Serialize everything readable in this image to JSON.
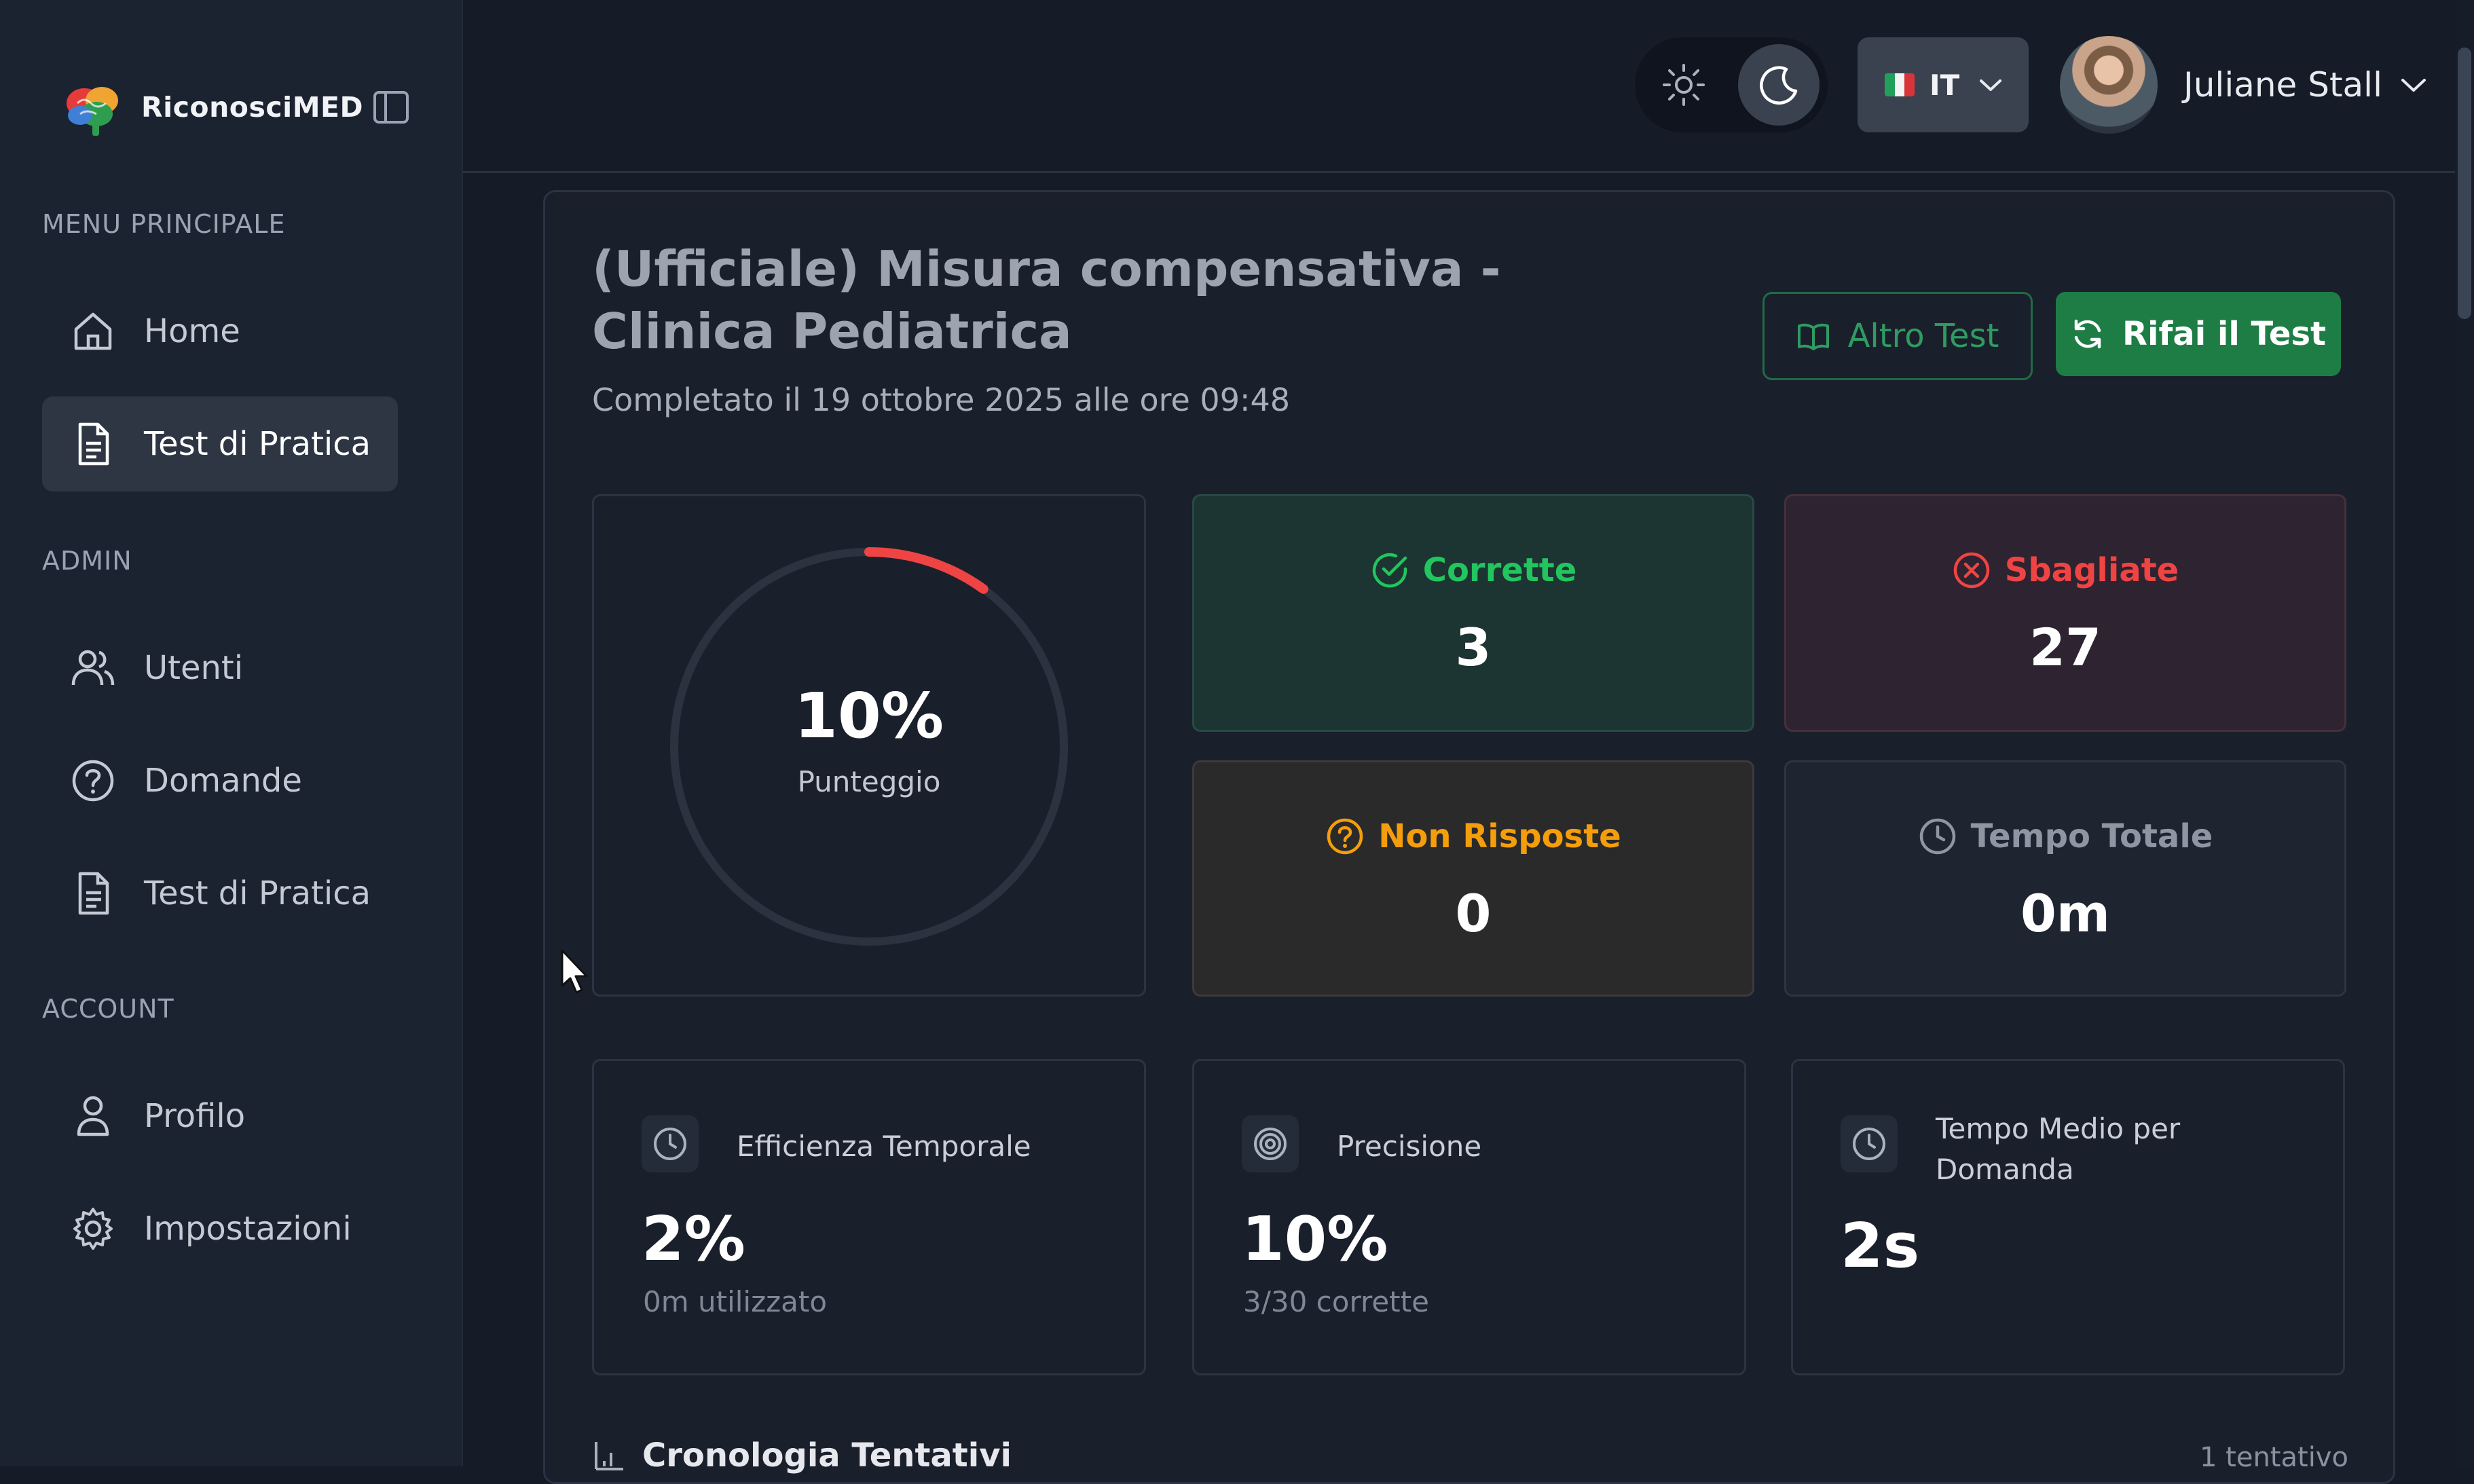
{
  "app": {
    "name": "RiconosciMED"
  },
  "sidebar": {
    "sections": [
      {
        "title": "MENU PRINCIPALE",
        "items": [
          {
            "label": "Home",
            "icon": "home-icon"
          },
          {
            "label": "Test di Pratica",
            "icon": "document-icon",
            "active": true
          }
        ]
      },
      {
        "title": "ADMIN",
        "items": [
          {
            "label": "Utenti",
            "icon": "users-icon"
          },
          {
            "label": "Domande",
            "icon": "question-circle-icon"
          },
          {
            "label": "Test di Pratica",
            "icon": "document-icon"
          }
        ]
      },
      {
        "title": "ACCOUNT",
        "items": [
          {
            "label": "Profilo",
            "icon": "user-icon"
          },
          {
            "label": "Impostazioni",
            "icon": "gear-icon"
          }
        ]
      }
    ]
  },
  "header": {
    "language": "IT",
    "user_name": "Juliane Stall",
    "theme": "dark"
  },
  "result": {
    "title": "(Ufficiale) Misura compensativa - Clinica Pediatrica",
    "completed": "Completato il 19 ottobre 2025 alle ore 09:48",
    "buttons": {
      "other": "Altro Test",
      "retake": "Rifai il Test"
    },
    "score": {
      "value": "10%",
      "fraction": 0.1,
      "label": "Punteggio"
    },
    "stats": {
      "correct": {
        "label": "Corrette",
        "value": "3"
      },
      "wrong": {
        "label": "Sbagliate",
        "value": "27"
      },
      "unanswered": {
        "label": "Non Risposte",
        "value": "0"
      },
      "total_time": {
        "label": "Tempo Totale",
        "value": "0m"
      }
    },
    "metrics": [
      {
        "title": "Efficienza Temporale",
        "value": "2%",
        "sub": "0m utilizzato",
        "icon": "clock-icon"
      },
      {
        "title": "Precisione",
        "value": "10%",
        "sub": "3/30 corrette",
        "icon": "target-icon"
      },
      {
        "title": "Tempo Medio per Domanda",
        "value": "2s",
        "sub": "",
        "icon": "clock-icon"
      }
    ],
    "history": {
      "title": "Cronologia Tentativi",
      "count": "1 tentativo"
    }
  },
  "colors": {
    "accent_green": "#1e7d45",
    "correct": "#22c55e",
    "wrong": "#ef4444",
    "unanswered": "#f59e0b",
    "score_arc": "#ef4444"
  }
}
